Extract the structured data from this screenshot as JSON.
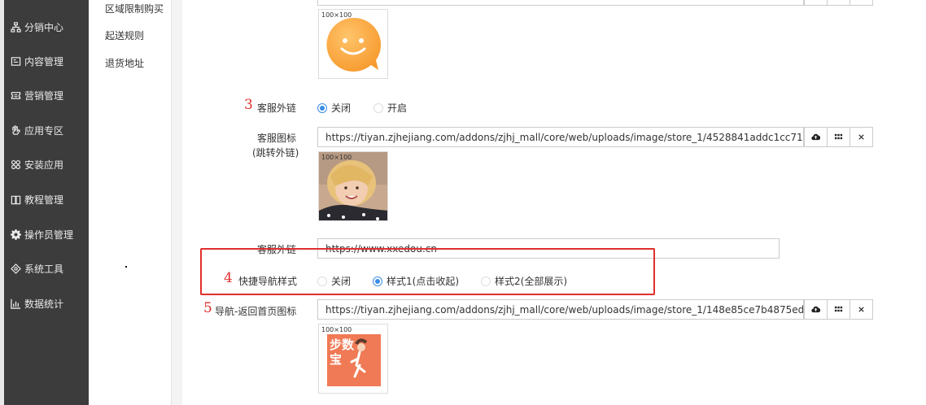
{
  "sidebar": {
    "items": [
      {
        "label": "分销中心",
        "icon": "sitemap-icon"
      },
      {
        "label": "内容管理",
        "icon": "content-icon"
      },
      {
        "label": "营销管理",
        "icon": "ticket-icon"
      },
      {
        "label": "应用专区",
        "icon": "hand-icon"
      },
      {
        "label": "安装应用",
        "icon": "apps-icon"
      },
      {
        "label": "教程管理",
        "icon": "book-icon"
      },
      {
        "label": "操作员管理",
        "icon": "gear-icon"
      },
      {
        "label": "系统工具",
        "icon": "tools-icon"
      },
      {
        "label": "数据统计",
        "icon": "bar-chart-icon"
      }
    ]
  },
  "subnav": {
    "items": [
      "区域限制购买",
      "起送规则",
      "退货地址"
    ]
  },
  "form": {
    "thumb_size": "100×100",
    "service_link": {
      "marker": "3",
      "label": "客服外链",
      "options": [
        "关闭",
        "开启"
      ],
      "selected": "关闭"
    },
    "service_icon": {
      "label": "客服图标",
      "sublabel": "(跳转外链)",
      "url": "https://tiyan.zjhejiang.com/addons/zjhj_mall/core/web/uploads/image/store_1/4528841addc1cc717226a12c6"
    },
    "service_link_url": {
      "label": "客服外链",
      "value": "https://www.xxedou.cn"
    },
    "quick_nav": {
      "marker": "4",
      "label": "快捷导航样式",
      "options": [
        "关闭",
        "样式1(点击收起)",
        "样式2(全部展示)"
      ],
      "selected": "样式1(点击收起)"
    },
    "home_icon": {
      "marker": "5",
      "label": "导航-返回首页图标",
      "url": "https://tiyan.zjhejiang.com/addons/zjhj_mall/core/web/uploads/image/store_1/148e85ce7b4875ed477181150"
    },
    "home_icon_image_text": "步数宝"
  },
  "colors": {
    "sidebar_bg": "#3c3c3c",
    "accent": "#3a8ee6",
    "annotation_red": "#e0302e"
  }
}
